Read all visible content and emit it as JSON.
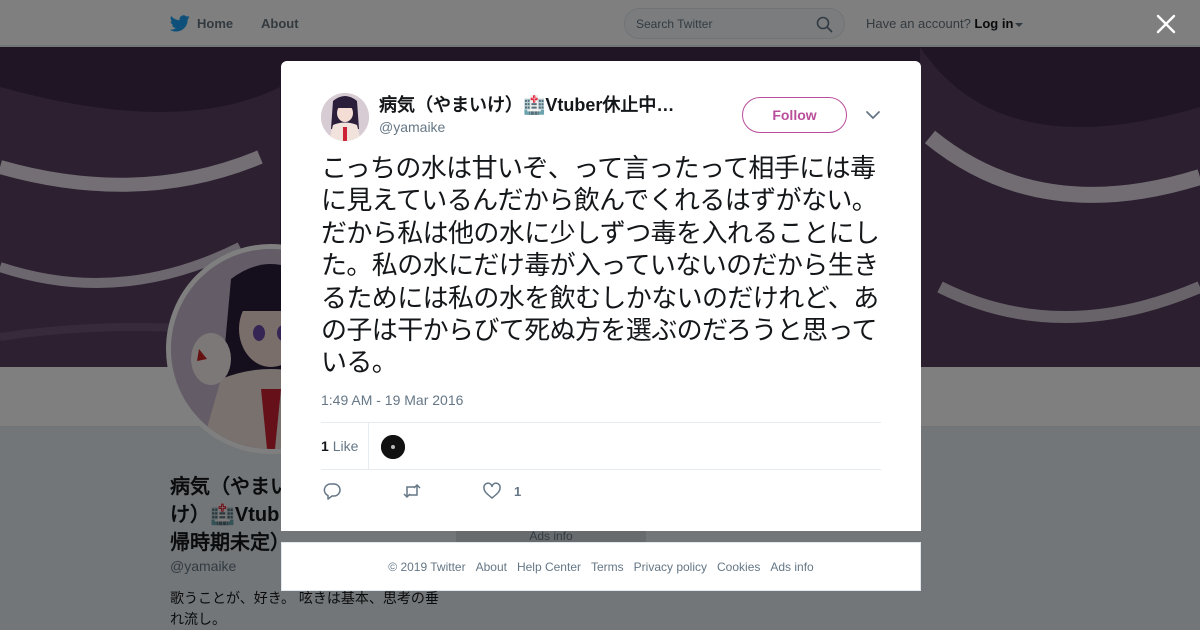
{
  "nav": {
    "home_label": "Home",
    "about_label": "About",
    "search_placeholder": "Search Twitter",
    "account_prompt": "Have an account?",
    "login_label": "Log in"
  },
  "profile": {
    "name": "病気（やまいけ）🏥Vtuber休止中（復帰時期未定）",
    "name_shown": "病気（やまい\nけ）🏥Vtub\n帰時期未定）",
    "handle": "@yamaike",
    "bio": "歌うことが、好き。 呟きは基本、思考の垂れ流し。",
    "ads_info": "Ads info"
  },
  "tweet": {
    "author_name": "病気（やまいけ）🏥Vtuber休止中…",
    "author_handle": "@yamaike",
    "follow_label": "Follow",
    "text": "こっちの水は甘いぞ、って言ったって相手には毒に見えているんだから飲んでくれるはずがない。だから私は他の水に少しずつ毒を入れることにした。私の水にだけ毒が入っていないのだから生きるためには私の水を飲むしかないのだけれど、あの子は干からびて死ぬ方を選ぶのだろうと思っている。",
    "timestamp": "1:49 AM - 19 Mar 2016",
    "like_count": "1",
    "like_label": "Like",
    "action_like_count": "1"
  },
  "footer": {
    "links": [
      "© 2019 Twitter",
      "About",
      "Help Center",
      "Terms",
      "Privacy policy",
      "Cookies",
      "Ads info"
    ]
  },
  "colors": {
    "twitter_blue": "#1da1f2",
    "profile_accent": "#b94e9a",
    "muted_text": "#657786",
    "overlay": "rgba(0,0,0,0.5)"
  },
  "icons": [
    "twitter-bird-icon",
    "search-icon",
    "caret-down-icon",
    "close-icon",
    "chevron-down-icon",
    "reply-icon",
    "retweet-icon",
    "heart-icon"
  ]
}
